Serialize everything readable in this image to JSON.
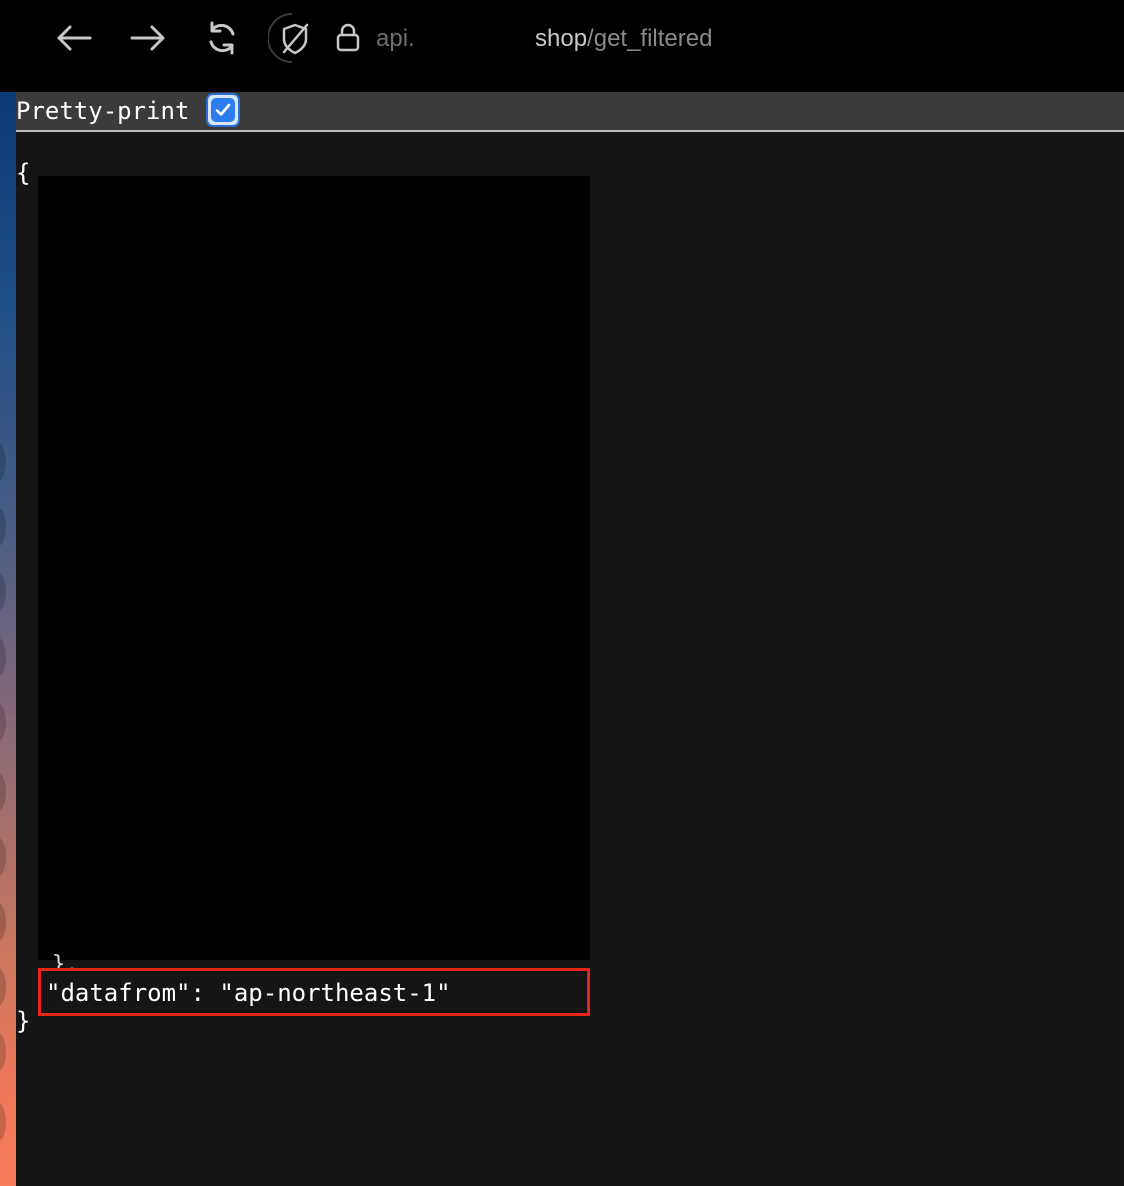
{
  "toolbar": {
    "icons": [
      "back-arrow-icon",
      "forward-arrow-icon",
      "reload-icon",
      "tracking-shield-icon",
      "lock-icon"
    ],
    "url_prefix": "api.",
    "url_host": "shop",
    "url_path": "/get_filtered"
  },
  "viewer": {
    "pretty_print_label": "Pretty-print",
    "pretty_print_checked": true,
    "json_open": "{",
    "json_close": "}",
    "truncated_line": "},",
    "datafrom_line": "\"datafrom\": \"ap-northeast-1\""
  },
  "colors": {
    "highlight_border": "#e8241b",
    "checkbox_accent": "#2e7df0",
    "viewer_bg": "#151515"
  }
}
